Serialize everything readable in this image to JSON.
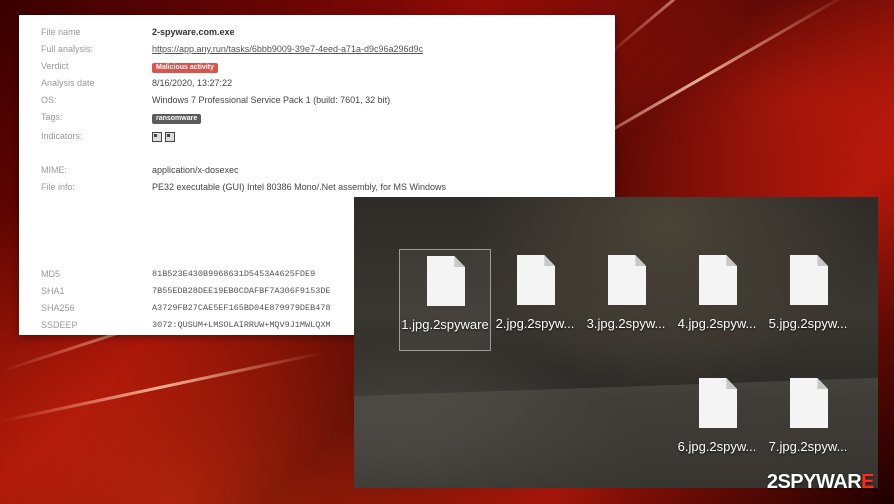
{
  "analysis": {
    "rows": [
      {
        "label": "File name",
        "value": "2-spyware.com.exe"
      },
      {
        "label": "Full analysis:",
        "value": "https://app.any.run/tasks/6bbb9009-39e7-4eed-a71a-d9c96a296d9c"
      },
      {
        "label": "Verdict",
        "value": "Malicious activity"
      },
      {
        "label": "Analysis date",
        "value": "8/16/2020, 13:27:22"
      },
      {
        "label": "OS:",
        "value": "Windows 7 Professional Service Pack 1 (build: 7601, 32 bit)"
      },
      {
        "label": "Tags:",
        "value": "ransomware"
      },
      {
        "label": "Indicators:",
        "value": ""
      },
      {
        "label": "MIME:",
        "value": "application/x-dosexec"
      },
      {
        "label": "File info:",
        "value": "PE32 executable (GUI) Intel 80386 Mono/.Net assembly, for MS Windows"
      },
      {
        "label": "MD5",
        "value": "81B523E430B9968631D5453A4625FDE9"
      },
      {
        "label": "SHA1",
        "value": "7B55EDB28DEE19EB0CDAFBF7A306F9153DE"
      },
      {
        "label": "SHA256",
        "value": "A3729FB27CAE5EF165BD04E879979DEB478"
      },
      {
        "label": "SSDEEP",
        "value": "3072:QUSUM+LMSOLAIRRUW+MQV9J1MWLQXM"
      }
    ]
  },
  "explorer": {
    "files": [
      {
        "name": "1.jpg.2spyware"
      },
      {
        "name": "2.jpg.2spyw..."
      },
      {
        "name": "3.jpg.2spyw..."
      },
      {
        "name": "4.jpg.2spyw..."
      },
      {
        "name": "5.jpg.2spyw..."
      },
      {
        "name": "6.jpg.2spyw..."
      },
      {
        "name": "7.jpg.2spyw..."
      }
    ]
  },
  "logo": {
    "prefix": "2",
    "main": "SPYWAR",
    "suffix": "E"
  },
  "colors": {
    "accent": "#ff2a1a",
    "verdict": "#d9534f",
    "tag": "#5b5b5b"
  }
}
